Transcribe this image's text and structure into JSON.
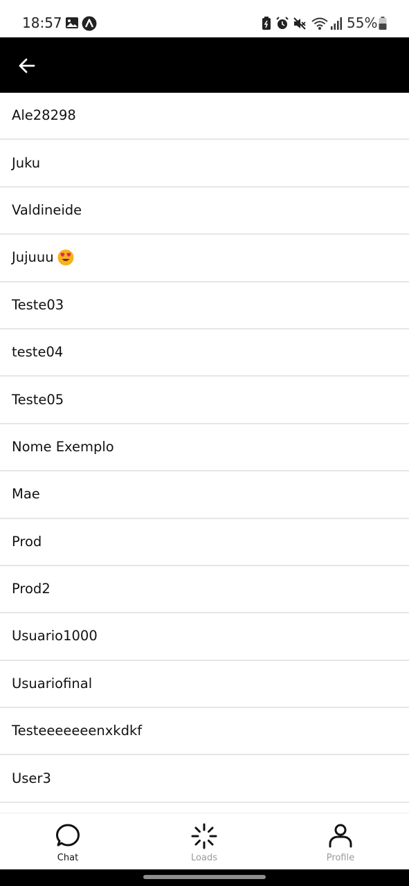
{
  "status_bar": {
    "time": "18:57",
    "battery": "55%",
    "icons": [
      "gallery-icon",
      "app-notification-icon",
      "battery-saver-icon",
      "alarm-icon",
      "mute-icon",
      "wifi-icon",
      "signal-icon",
      "battery-icon"
    ]
  },
  "header": {
    "back_icon": "arrow-left-icon",
    "background": "#000000"
  },
  "chats": [
    {
      "label": "Ale28298"
    },
    {
      "label": "Juku"
    },
    {
      "label": "Valdineide"
    },
    {
      "label": "Jujuuu",
      "emoji": "heart-eyes-emoji"
    },
    {
      "label": "Teste03"
    },
    {
      "label": "teste04"
    },
    {
      "label": "Teste05"
    },
    {
      "label": "Nome Exemplo"
    },
    {
      "label": "Mae"
    },
    {
      "label": "Prod"
    },
    {
      "label": "Prod2"
    },
    {
      "label": "Usuario1000"
    },
    {
      "label": "Usuariofinal"
    },
    {
      "label": "Testeeeeeeenxkdkf"
    },
    {
      "label": "User3"
    },
    {
      "label": ""
    }
  ],
  "nav": {
    "chat": {
      "label": "Chat",
      "icon": "chat-bubble-icon",
      "active": true
    },
    "loads": {
      "label": "Loads",
      "icon": "loading-spinner-icon",
      "active": false
    },
    "profile": {
      "label": "Profile",
      "icon": "user-icon",
      "active": false
    }
  },
  "colors": {
    "active": "#111111",
    "inactive": "#9a9a9a",
    "divider": "#e6e6e6"
  }
}
